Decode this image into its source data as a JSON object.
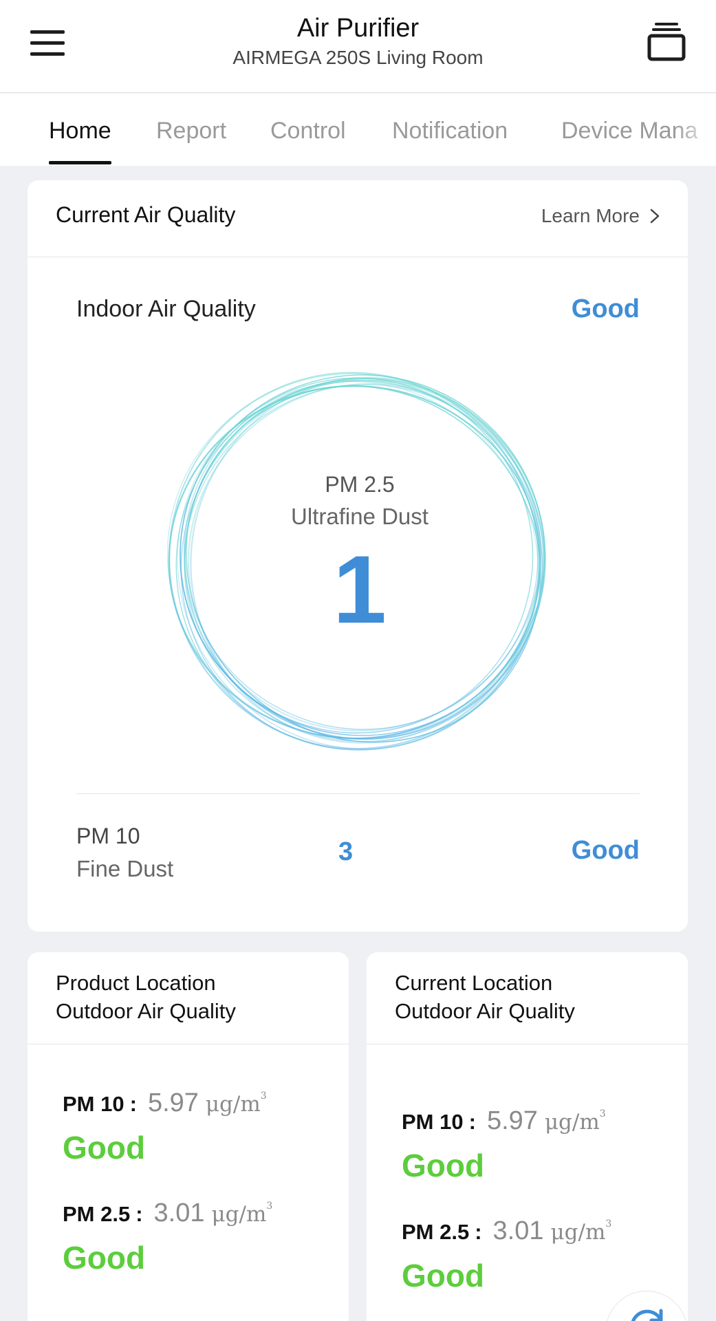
{
  "header": {
    "title": "Air Purifier",
    "subtitle": "AIRMEGA 250S Living Room",
    "menu_icon": "hamburger-menu-icon",
    "device_icon": "device-stack-icon"
  },
  "tabs": [
    {
      "label": "Home",
      "active": true
    },
    {
      "label": "Report",
      "active": false
    },
    {
      "label": "Control",
      "active": false
    },
    {
      "label": "Notification",
      "active": false
    },
    {
      "label": "Device Mana",
      "active": false
    }
  ],
  "current_air_quality": {
    "title": "Current Air Quality",
    "learn_more": "Learn More",
    "indoor_label": "Indoor Air Quality",
    "indoor_status": "Good",
    "pm25": {
      "label": "PM 2.5",
      "sublabel": "Ultrafine Dust",
      "value": "1"
    },
    "pm10": {
      "label": "PM 10",
      "sublabel": "Fine Dust",
      "value": "3",
      "status": "Good"
    }
  },
  "outdoor_product": {
    "title_line1": "Product Location",
    "title_line2": "Outdoor Air Quality",
    "pm10": {
      "label": "PM 10",
      "colon": ":",
      "value": "5.97",
      "unit": "μg/m",
      "unit_exp": "3",
      "status": "Good"
    },
    "pm25": {
      "label": "PM 2.5",
      "colon": ":",
      "value": "3.01",
      "unit": "μg/m",
      "unit_exp": "3",
      "status": "Good"
    }
  },
  "outdoor_current": {
    "title_line1": "Current Location",
    "title_line2": "Outdoor Air Quality",
    "pm10": {
      "label": "PM 10",
      "colon": ":",
      "value": "5.97",
      "unit": "μg/m",
      "unit_exp": "3",
      "status": "Good"
    },
    "pm25": {
      "label": "PM 2.5",
      "colon": ":",
      "value": "3.01",
      "unit": "μg/m",
      "unit_exp": "3",
      "status": "Good"
    }
  },
  "colors": {
    "accent_blue": "#3f8dd6",
    "good_green": "#5ccd3c",
    "ring_teal": "#5fd6c6",
    "ring_blue": "#4aa6e6"
  },
  "fab_icon": "refresh-icon"
}
